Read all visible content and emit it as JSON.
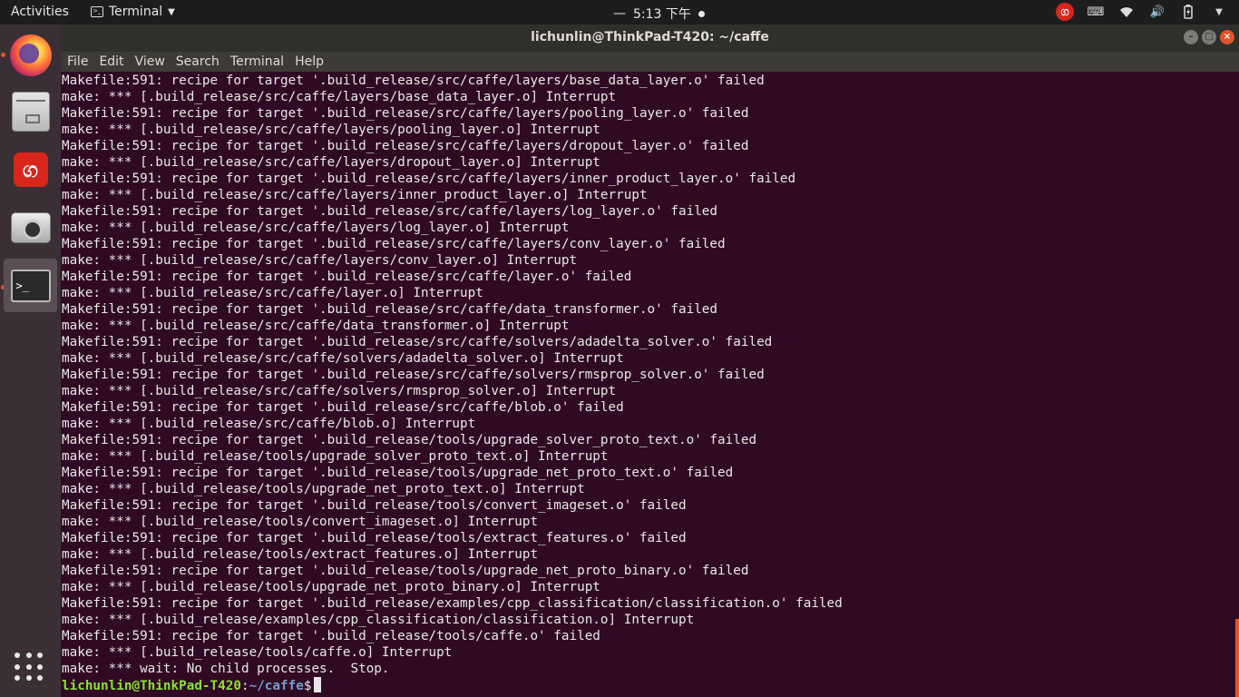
{
  "topbar": {
    "activities": "Activities",
    "app_menu": "Terminal",
    "clock": "5:13 下午",
    "clock_dash": "—"
  },
  "window": {
    "title": "lichunlin@ThinkPad-T420: ~/caffe"
  },
  "menu": [
    "File",
    "Edit",
    "View",
    "Search",
    "Terminal",
    "Help"
  ],
  "terminal": {
    "lines": [
      "Makefile:591: recipe for target '.build_release/src/caffe/layers/base_data_layer.o' failed",
      "make: *** [.build_release/src/caffe/layers/base_data_layer.o] Interrupt",
      "Makefile:591: recipe for target '.build_release/src/caffe/layers/pooling_layer.o' failed",
      "make: *** [.build_release/src/caffe/layers/pooling_layer.o] Interrupt",
      "Makefile:591: recipe for target '.build_release/src/caffe/layers/dropout_layer.o' failed",
      "make: *** [.build_release/src/caffe/layers/dropout_layer.o] Interrupt",
      "Makefile:591: recipe for target '.build_release/src/caffe/layers/inner_product_layer.o' failed",
      "make: *** [.build_release/src/caffe/layers/inner_product_layer.o] Interrupt",
      "Makefile:591: recipe for target '.build_release/src/caffe/layers/log_layer.o' failed",
      "make: *** [.build_release/src/caffe/layers/log_layer.o] Interrupt",
      "Makefile:591: recipe for target '.build_release/src/caffe/layers/conv_layer.o' failed",
      "make: *** [.build_release/src/caffe/layers/conv_layer.o] Interrupt",
      "Makefile:591: recipe for target '.build_release/src/caffe/layer.o' failed",
      "make: *** [.build_release/src/caffe/layer.o] Interrupt",
      "Makefile:591: recipe for target '.build_release/src/caffe/data_transformer.o' failed",
      "make: *** [.build_release/src/caffe/data_transformer.o] Interrupt",
      "Makefile:591: recipe for target '.build_release/src/caffe/solvers/adadelta_solver.o' failed",
      "make: *** [.build_release/src/caffe/solvers/adadelta_solver.o] Interrupt",
      "Makefile:591: recipe for target '.build_release/src/caffe/solvers/rmsprop_solver.o' failed",
      "make: *** [.build_release/src/caffe/solvers/rmsprop_solver.o] Interrupt",
      "Makefile:591: recipe for target '.build_release/src/caffe/blob.o' failed",
      "make: *** [.build_release/src/caffe/blob.o] Interrupt",
      "Makefile:591: recipe for target '.build_release/tools/upgrade_solver_proto_text.o' failed",
      "make: *** [.build_release/tools/upgrade_solver_proto_text.o] Interrupt",
      "Makefile:591: recipe for target '.build_release/tools/upgrade_net_proto_text.o' failed",
      "make: *** [.build_release/tools/upgrade_net_proto_text.o] Interrupt",
      "Makefile:591: recipe for target '.build_release/tools/convert_imageset.o' failed",
      "make: *** [.build_release/tools/convert_imageset.o] Interrupt",
      "Makefile:591: recipe for target '.build_release/tools/extract_features.o' failed",
      "make: *** [.build_release/tools/extract_features.o] Interrupt",
      "Makefile:591: recipe for target '.build_release/tools/upgrade_net_proto_binary.o' failed",
      "make: *** [.build_release/tools/upgrade_net_proto_binary.o] Interrupt",
      "Makefile:591: recipe for target '.build_release/examples/cpp_classification/classification.o' failed",
      "make: *** [.build_release/examples/cpp_classification/classification.o] Interrupt",
      "Makefile:591: recipe for target '.build_release/tools/caffe.o' failed",
      "make: *** [.build_release/tools/caffe.o] Interrupt",
      "make: *** wait: No child processes.  Stop."
    ],
    "prompt": {
      "user_host": "lichunlin@ThinkPad-T420",
      "separator": ":",
      "path": "~/caffe",
      "symbol": "$"
    }
  },
  "dock": [
    "firefox-icon",
    "files-icon",
    "netease-music-icon",
    "camera-icon",
    "terminal-icon",
    "show-apps-icon"
  ],
  "colors": {
    "terminal_bg": "#300a24",
    "prompt_user": "#8ae234",
    "prompt_path": "#729fcf",
    "accent": "#e95420"
  }
}
